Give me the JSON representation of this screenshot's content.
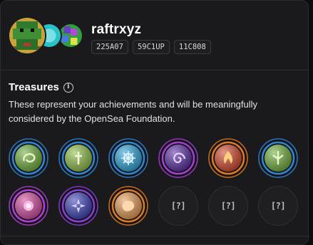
{
  "profile": {
    "username": "raftrxyz",
    "tags": [
      "225A07",
      "59C1UP",
      "11C808"
    ]
  },
  "treasures": {
    "title": "Treasures",
    "info_icon": "info-icon",
    "description": "These represent your achievements and will be meaningfully considered by the OpenSea Foundation.",
    "badges": [
      {
        "name": "treasure-badge-1",
        "ring": "#2f86d6",
        "core": "#6fae3a",
        "glyph": "swirl"
      },
      {
        "name": "treasure-badge-2",
        "ring": "#2f86d6",
        "core": "#8dbf44",
        "glyph": "cross"
      },
      {
        "name": "treasure-badge-3",
        "ring": "#2f86d6",
        "core": "#2aa4d8",
        "glyph": "gear"
      },
      {
        "name": "treasure-badge-4",
        "ring": "#a53ed6",
        "core": "#5b2aa6",
        "glyph": "spiral"
      },
      {
        "name": "treasure-badge-5",
        "ring": "#e07a22",
        "core": "#d4452a",
        "glyph": "flame"
      },
      {
        "name": "treasure-badge-6",
        "ring": "#2f86d6",
        "core": "#6fae3a",
        "glyph": "tree"
      },
      {
        "name": "treasure-badge-7",
        "ring": "#b240d8",
        "core": "#d24aa0",
        "glyph": "pink"
      },
      {
        "name": "treasure-badge-8",
        "ring": "#8b3fd8",
        "core": "#3a3fb8",
        "glyph": "compass"
      },
      {
        "name": "treasure-badge-9",
        "ring": "#e07a22",
        "core": "#e89a55",
        "glyph": "blob"
      }
    ],
    "locked_label": "[?]",
    "locked_count": 3
  }
}
